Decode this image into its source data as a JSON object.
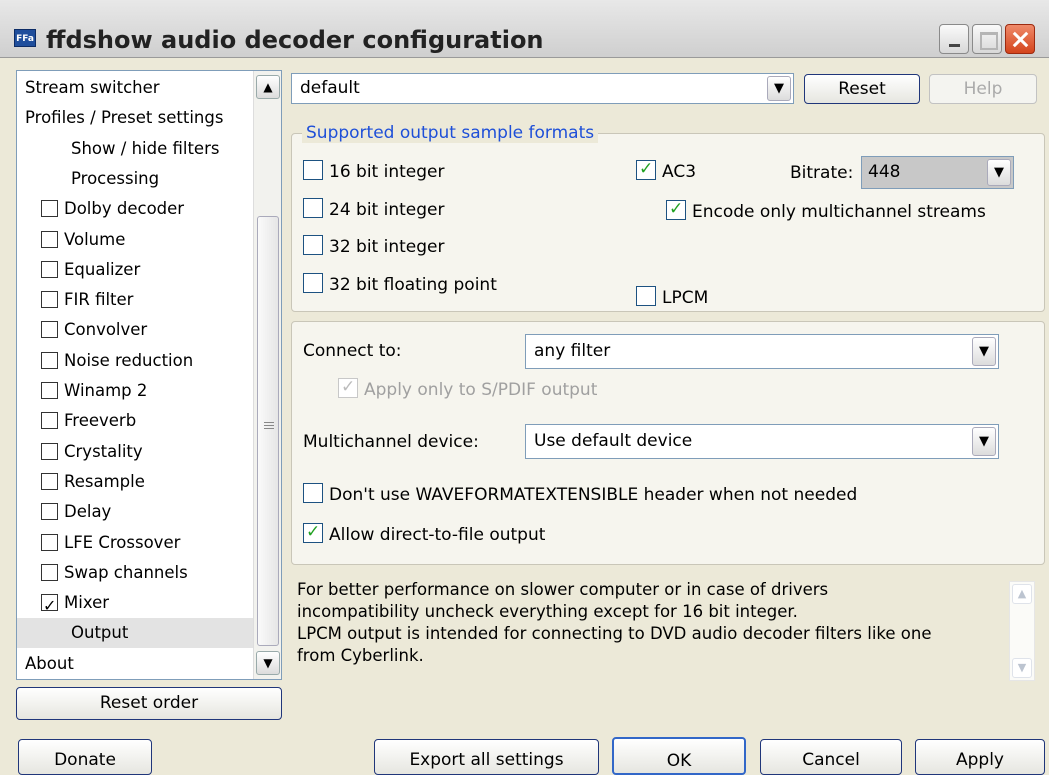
{
  "window": {
    "title": "ffdshow audio decoder configuration",
    "icon_label": "FFa"
  },
  "tree": {
    "items": [
      {
        "label": "Stream switcher",
        "checkbox": false,
        "indent": 0
      },
      {
        "label": "Profiles / Preset settings",
        "checkbox": false,
        "indent": 0
      },
      {
        "label": "Show / hide filters",
        "checkbox": false,
        "indent": 2
      },
      {
        "label": "Processing",
        "checkbox": false,
        "indent": 2
      },
      {
        "label": "Dolby decoder",
        "checkbox": true,
        "checked": false
      },
      {
        "label": "Volume",
        "checkbox": true,
        "checked": false
      },
      {
        "label": "Equalizer",
        "checkbox": true,
        "checked": false
      },
      {
        "label": "FIR filter",
        "checkbox": true,
        "checked": false
      },
      {
        "label": "Convolver",
        "checkbox": true,
        "checked": false
      },
      {
        "label": "Noise reduction",
        "checkbox": true,
        "checked": false
      },
      {
        "label": "Winamp 2",
        "checkbox": true,
        "checked": false
      },
      {
        "label": "Freeverb",
        "checkbox": true,
        "checked": false
      },
      {
        "label": "Crystality",
        "checkbox": true,
        "checked": false
      },
      {
        "label": "Resample",
        "checkbox": true,
        "checked": false
      },
      {
        "label": "Delay",
        "checkbox": true,
        "checked": false
      },
      {
        "label": "LFE Crossover",
        "checkbox": true,
        "checked": false
      },
      {
        "label": "Swap channels",
        "checkbox": true,
        "checked": false
      },
      {
        "label": "Mixer",
        "checkbox": true,
        "checked": true
      },
      {
        "label": "Output",
        "checkbox": false,
        "indent": 2,
        "selected": true
      },
      {
        "label": "About",
        "checkbox": false,
        "indent": 0
      }
    ],
    "reset_order_label": "Reset order"
  },
  "profile": {
    "value": "default",
    "reset_label": "Reset",
    "help_label": "Help"
  },
  "formats": {
    "title": "Supported output sample formats",
    "int16": {
      "label": "16 bit integer",
      "checked": false
    },
    "int24": {
      "label": "24 bit integer",
      "checked": false
    },
    "int32": {
      "label": "32 bit integer",
      "checked": false
    },
    "float32": {
      "label": "32 bit floating point",
      "checked": false
    },
    "ac3": {
      "label": "AC3",
      "checked": true
    },
    "bitrate_label": "Bitrate:",
    "bitrate_value": "448",
    "encode_multichannel": {
      "label": "Encode only multichannel streams",
      "checked": true
    },
    "lpcm": {
      "label": "LPCM",
      "checked": false
    }
  },
  "connection": {
    "connect_label": "Connect to:",
    "connect_value": "any filter",
    "spdif_only": {
      "label": "Apply only to S/PDIF output",
      "checked": true
    },
    "device_label": "Multichannel device:",
    "device_value": "Use default device",
    "no_waveformatext": {
      "label": "Don't use WAVEFORMATEXTENSIBLE header when not needed",
      "checked": false
    },
    "direct_to_file": {
      "label": "Allow direct-to-file output",
      "checked": true
    }
  },
  "info": {
    "lines": [
      "For better performance on slower computer or in case of drivers",
      "incompatibility uncheck everything except for 16 bit integer.",
      "LPCM output is intended for connecting to DVD audio decoder filters like one",
      "from Cyberlink."
    ]
  },
  "footer": {
    "donate": "Donate",
    "export": "Export all settings",
    "ok": "OK",
    "cancel": "Cancel",
    "apply": "Apply"
  },
  "icons": {
    "scroll_up": "▲",
    "scroll_down": "▼",
    "dropdown": "▼"
  }
}
